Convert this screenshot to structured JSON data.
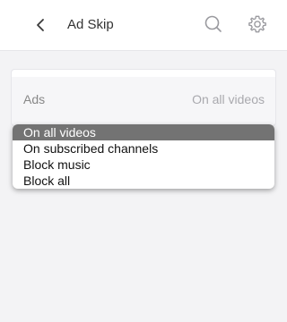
{
  "header": {
    "title": "Ad Skip",
    "back_icon": "chevron-left-icon",
    "search_icon": "search-icon",
    "settings_icon": "gear-icon"
  },
  "settings": {
    "ads": {
      "label": "Ads",
      "value": "On all videos"
    }
  },
  "dropdown": {
    "options": [
      "On all videos",
      "On subscribed channels",
      "Block music",
      "Block all"
    ],
    "selected": "On all videos",
    "selected_color": "#737373"
  }
}
